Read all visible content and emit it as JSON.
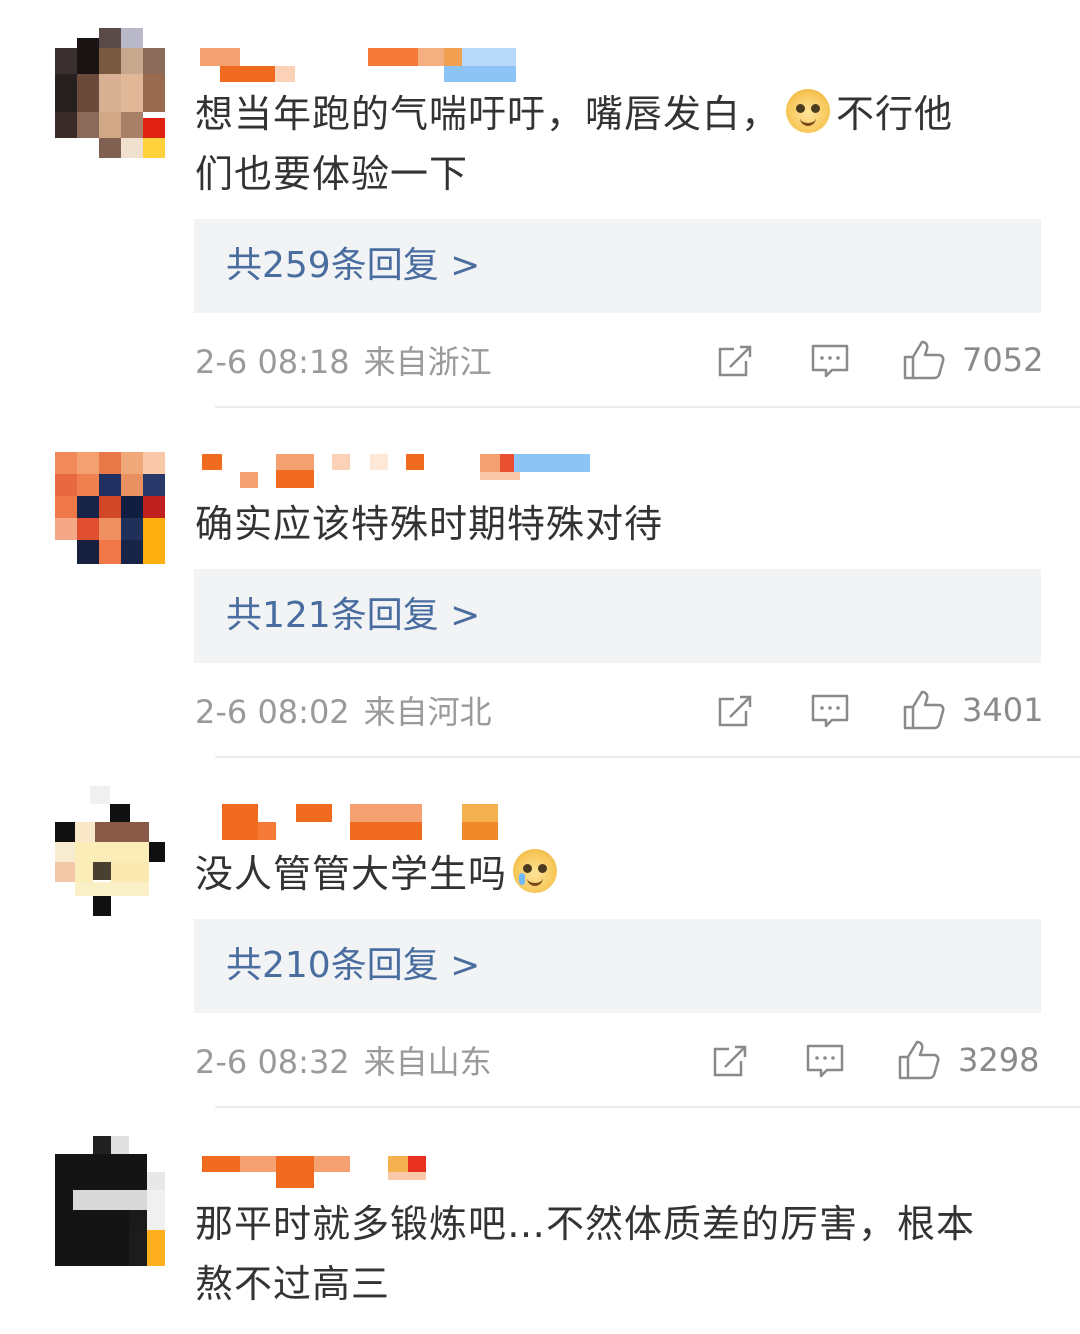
{
  "comments": [
    {
      "text_line1": "想当年跑的气喘吁吁，嘴唇发白，",
      "text_after_emoji": "不行他",
      "text_line2": "们也要体验一下",
      "replies": "共259条回复 >",
      "time": "2-6 08:18",
      "location": "来自浙江",
      "likes": "7052"
    },
    {
      "text": "确实应该特殊时期特殊对待",
      "replies": "共121条回复 >",
      "time": "2-6 08:02",
      "location": "来自河北",
      "likes": "3401"
    },
    {
      "text": "没人管管大学生吗",
      "replies": "共210条回复 >",
      "time": "2-6 08:32",
      "location": "来自山东",
      "likes": "3298"
    },
    {
      "text_line1": "那平时就多锻炼吧…不然体质差的厉害，根本",
      "text_line2": "熬不过高三"
    }
  ],
  "icons": {
    "share": "share-icon",
    "comment": "comment-icon",
    "like": "thumbs-up-icon",
    "emoji1": "doge-emoji-icon",
    "emoji2": "crying-doge-emoji-icon"
  },
  "colors": {
    "reply_link": "#4a6da0",
    "reply_bg": "#f2f3f5",
    "meta": "#9a9a9a",
    "text": "#333333"
  }
}
